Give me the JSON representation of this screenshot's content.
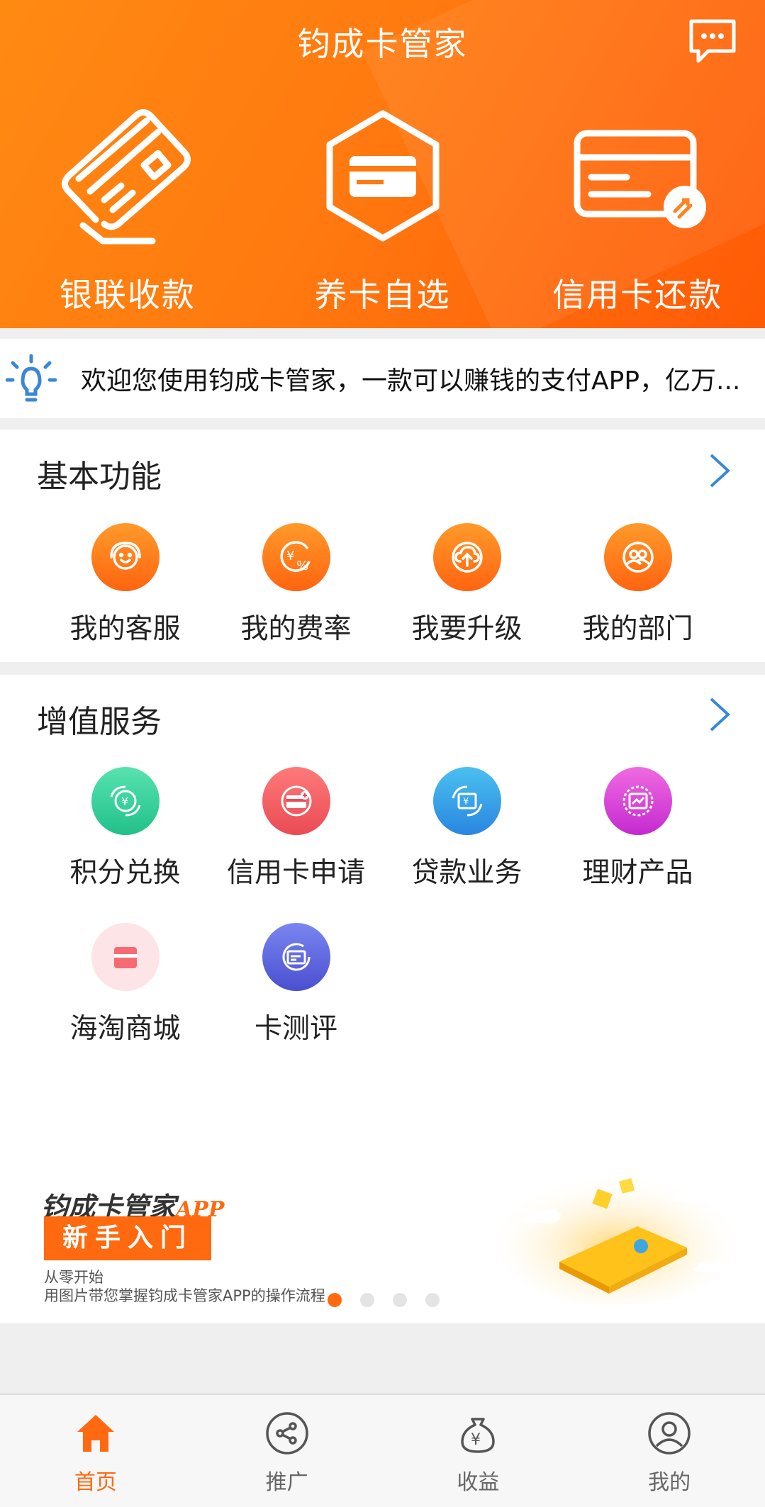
{
  "header": {
    "title": "钧成卡管家",
    "items": [
      {
        "label": "银联收款",
        "icon": "card-icon"
      },
      {
        "label": "养卡自选",
        "icon": "hexagon-card-icon"
      },
      {
        "label": "信用卡还款",
        "icon": "card-repay-icon"
      }
    ],
    "message_icon": "message-icon"
  },
  "notice": {
    "icon": "lightbulb-icon",
    "text": "欢迎您使用钧成卡管家，一款可以赚钱的支付APP，亿万..."
  },
  "basic": {
    "title": "基本功能",
    "items": [
      {
        "label": "我的客服",
        "icon": "customer-service-icon"
      },
      {
        "label": "我的费率",
        "icon": "rate-icon"
      },
      {
        "label": "我要升级",
        "icon": "upgrade-icon"
      },
      {
        "label": "我的部门",
        "icon": "department-icon"
      }
    ]
  },
  "value": {
    "title": "增值服务",
    "items": [
      {
        "label": "积分兑换",
        "icon": "points-exchange-icon"
      },
      {
        "label": "信用卡申请",
        "icon": "credit-card-apply-icon"
      },
      {
        "label": "贷款业务",
        "icon": "loan-icon"
      },
      {
        "label": "理财产品",
        "icon": "finance-icon"
      },
      {
        "label": "海淘商城",
        "icon": "shop-icon"
      },
      {
        "label": "卡测评",
        "icon": "card-review-icon"
      }
    ]
  },
  "banner": {
    "title": "钧成卡管家",
    "title_suffix": "APP",
    "tag": "新手入门",
    "sub1": "从零开始",
    "sub2": "用图片带您掌握钧成卡管家APP的操作流程",
    "dots": 4,
    "active_dot": 0
  },
  "tabs": [
    {
      "label": "首页",
      "icon": "home-icon",
      "active": true
    },
    {
      "label": "推广",
      "icon": "share-icon",
      "active": false
    },
    {
      "label": "收益",
      "icon": "money-bag-icon",
      "active": false
    },
    {
      "label": "我的",
      "icon": "user-icon",
      "active": false
    }
  ],
  "colors": {
    "accent": "#ff6a10",
    "header_from": "#ff8a12",
    "header_to": "#ff5a06"
  }
}
